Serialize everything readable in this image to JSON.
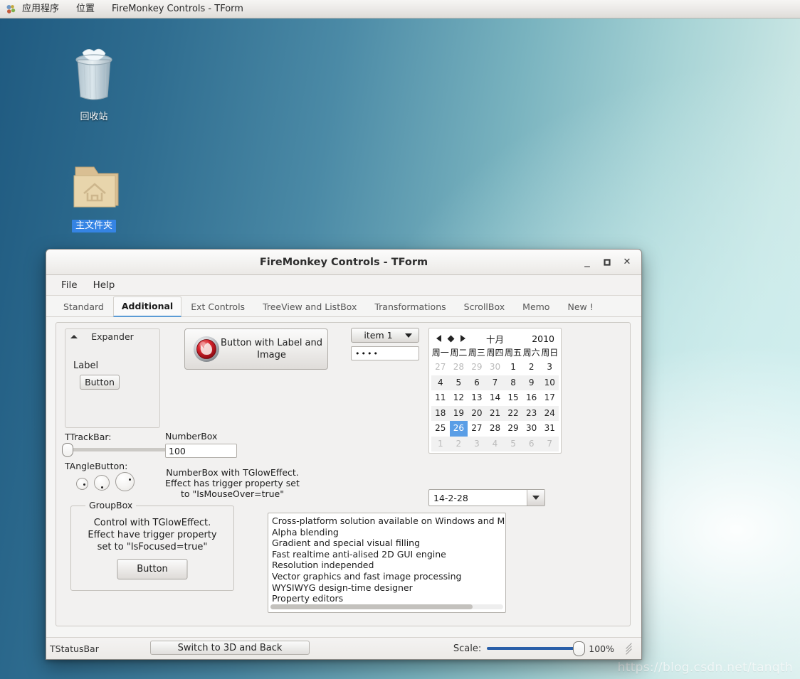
{
  "desktop": {
    "top_panel": {
      "logo_icon": "gnome-foot-icon",
      "items": [
        "应用程序",
        "位置"
      ],
      "window_title": "FireMonkey Controls - TForm"
    },
    "icons": [
      {
        "name": "trash-icon",
        "label": "回收站",
        "selected": false
      },
      {
        "name": "home-folder-icon",
        "label": "主文件夹",
        "selected": true
      }
    ],
    "watermark": "https://blog.csdn.net/tanqth"
  },
  "window": {
    "title": "FireMonkey Controls - TForm",
    "buttons": {
      "minimize": "_",
      "maximize": "❐",
      "close": "✕"
    },
    "menu": [
      "File",
      "Help"
    ],
    "tabs": [
      {
        "label": "Standard",
        "active": false
      },
      {
        "label": "Additional",
        "active": true
      },
      {
        "label": "Ext Controls",
        "active": false
      },
      {
        "label": "TreeView and ListBox",
        "active": false
      },
      {
        "label": "Transformations",
        "active": false
      },
      {
        "label": "ScrollBox",
        "active": false
      },
      {
        "label": "Memo",
        "active": false
      },
      {
        "label": "New !",
        "active": false
      }
    ]
  },
  "expander": {
    "title": "Expander",
    "arrow_icon": "chevron-up-icon",
    "label": "Label",
    "button": "Button"
  },
  "trackbar": {
    "label": "TTrackBar:",
    "value": 0
  },
  "anglebutton": {
    "label": "TAngleButton:"
  },
  "groupbox": {
    "title": "GroupBox",
    "text_line1": "Control with TGlowEffect.",
    "text_line2": "Effect have trigger property",
    "text_line3": "set to \"IsFocused=true\"",
    "button": "Button"
  },
  "image_button": {
    "icon": "firemonkey-logo-icon",
    "text_line1": "Button with Label and",
    "text_line2": "Image"
  },
  "numberbox": {
    "label": "NumberBox",
    "value": "100",
    "desc_line1": "NumberBox with TGlowEffect.",
    "desc_line2": "Effect has trigger property set",
    "desc_line3": "to \"IsMouseOver=true\""
  },
  "combobox": {
    "value": "item 1",
    "arrow_icon": "chevron-down-icon"
  },
  "passwordbox": {
    "value": "••••"
  },
  "calendar": {
    "prev_icon": "triangle-left-icon",
    "today_icon": "diamond-icon",
    "next_icon": "triangle-right-icon",
    "month": "十月",
    "year": "2010",
    "day_headers": [
      "周一",
      "周二",
      "周三",
      "周四",
      "周五",
      "周六",
      "周日"
    ],
    "weeks": [
      {
        "alt": false,
        "days": [
          {
            "d": "27",
            "dim": true
          },
          {
            "d": "28",
            "dim": true
          },
          {
            "d": "29",
            "dim": true
          },
          {
            "d": "30",
            "dim": true
          },
          {
            "d": "1"
          },
          {
            "d": "2"
          },
          {
            "d": "3"
          }
        ]
      },
      {
        "alt": true,
        "days": [
          {
            "d": "4"
          },
          {
            "d": "5"
          },
          {
            "d": "6"
          },
          {
            "d": "7"
          },
          {
            "d": "8"
          },
          {
            "d": "9"
          },
          {
            "d": "10"
          }
        ]
      },
      {
        "alt": false,
        "days": [
          {
            "d": "11"
          },
          {
            "d": "12"
          },
          {
            "d": "13"
          },
          {
            "d": "14"
          },
          {
            "d": "15"
          },
          {
            "d": "16"
          },
          {
            "d": "17"
          }
        ]
      },
      {
        "alt": true,
        "days": [
          {
            "d": "18"
          },
          {
            "d": "19"
          },
          {
            "d": "20"
          },
          {
            "d": "21"
          },
          {
            "d": "22"
          },
          {
            "d": "23"
          },
          {
            "d": "24"
          }
        ]
      },
      {
        "alt": false,
        "days": [
          {
            "d": "25"
          },
          {
            "d": "26",
            "sel": true
          },
          {
            "d": "27"
          },
          {
            "d": "28"
          },
          {
            "d": "29"
          },
          {
            "d": "30"
          },
          {
            "d": "31"
          }
        ]
      },
      {
        "alt": true,
        "days": [
          {
            "d": "1",
            "dim": true
          },
          {
            "d": "2",
            "dim": true
          },
          {
            "d": "3",
            "dim": true
          },
          {
            "d": "4",
            "dim": true
          },
          {
            "d": "5",
            "dim": true
          },
          {
            "d": "6",
            "dim": true
          },
          {
            "d": "7",
            "dim": true
          }
        ]
      }
    ]
  },
  "datecombo": {
    "value": "14-2-28",
    "arrow_icon": "chevron-down-icon"
  },
  "listbox": {
    "items": [
      "Cross-platform solution available on Windows and Mac (",
      "Alpha blending",
      "Gradient and special visual filling",
      "Fast realtime anti-alised 2D GUI engine",
      "Resolution independed",
      "Vector graphics and fast image processing",
      "WYSIWYG design-time designer",
      "Property editors"
    ]
  },
  "statusbar": {
    "label": "TStatusBar",
    "switch_button": "Switch to 3D and Back",
    "scale_label": "Scale:",
    "scale_value": "100%",
    "grip_icon": "resize-grip-icon"
  },
  "colors": {
    "accent": "#5a9ee6",
    "tab_underline": "#5b9bd5",
    "scale_track": "#2a5fa8",
    "selection": "#3584e4"
  }
}
